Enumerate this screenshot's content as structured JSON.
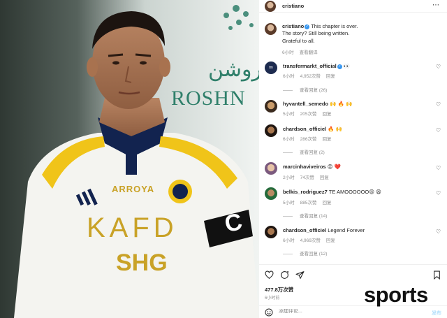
{
  "photo": {
    "sponsor_arabic": "روشن",
    "sponsor_latin": "ROSHN",
    "shirt_kafd": "KAFD",
    "shirt_shg": "SHG",
    "shirt_brand": "ARROYA",
    "armband": "C"
  },
  "header": {
    "username": "cristiano"
  },
  "caption": {
    "username": "cristiano",
    "lines": [
      "This chapter is over.",
      "The story? Still being written.",
      "Grateful to all."
    ],
    "time": "6小时",
    "translate": "查看翻译"
  },
  "comments": [
    {
      "username": "transfermarkt_official",
      "verified": true,
      "text": "👀",
      "time": "6小时",
      "likes": "4,952次赞",
      "reply": "回复",
      "view_replies": "查看回复 (26)"
    },
    {
      "username": "hyvantell_semedo",
      "verified": false,
      "text": "🙌 🔥 🙌",
      "time": "5小时",
      "likes": "205次赞",
      "reply": "回复"
    },
    {
      "username": "chardson_officiel",
      "verified": false,
      "text": "🔥 🙌",
      "time": "6小时",
      "likes": "286次赞",
      "reply": "回复",
      "view_replies": "查看回复 (2)"
    },
    {
      "username": "marcinhaviveiros",
      "verified": false,
      "text": "😍 ❤️",
      "time": "2小时",
      "likes": "74次赞",
      "reply": "回复"
    },
    {
      "username": "belkis_rodriguez7",
      "verified": false,
      "text": "TE AMOOOOOO😍 😫",
      "time": "5小时",
      "likes": "885次赞",
      "reply": "回复",
      "view_replies": "查看回复 (14)"
    },
    {
      "username": "chardson_officiel",
      "verified": false,
      "text": "Legend Forever",
      "time": "6小时",
      "likes": "4,969次赞",
      "reply": "回复",
      "view_replies": "查看回复 (12)"
    }
  ],
  "actions": {
    "likes": "477.8万次赞",
    "ago": "6小时前"
  },
  "composer": {
    "placeholder": "添加评论...",
    "post": "发布"
  },
  "watermark": "sports",
  "icons": {
    "like": "heart-icon",
    "comment": "comment-icon",
    "share": "send-icon",
    "save": "bookmark-icon",
    "emoji": "emoji-icon",
    "more": "more-icon"
  },
  "colors": {
    "link": "#3897f0",
    "muted": "#8e8e8e",
    "text": "#262626"
  }
}
